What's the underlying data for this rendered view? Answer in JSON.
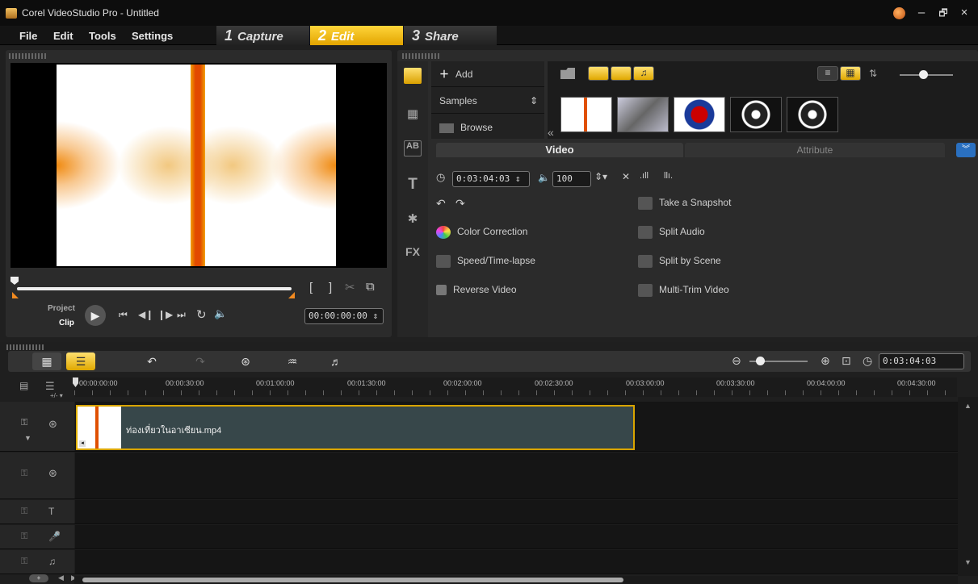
{
  "titlebar": {
    "title": "Corel VideoStudio Pro - Untitled"
  },
  "menu": {
    "items": [
      "File",
      "Edit",
      "Tools",
      "Settings"
    ]
  },
  "steps": [
    {
      "num": "1",
      "label": "Capture"
    },
    {
      "num": "2",
      "label": "Edit"
    },
    {
      "num": "3",
      "label": "Share"
    }
  ],
  "preview": {
    "project_label": "Project",
    "clip_label": "Clip",
    "timecode": "00:00:00:00",
    "progress": 0
  },
  "library": {
    "add_label": "Add",
    "folder_label": "Samples",
    "browse_label": "Browse",
    "collapse_glyph": "«",
    "tabs": {
      "video": "Video",
      "attribute": "Attribute"
    },
    "duration": "0:03:04:03",
    "volume": "100",
    "options_left": [
      "Color Correction",
      "Speed/Time-lapse",
      "Reverse Video"
    ],
    "options_right": [
      "Take a Snapshot",
      "Split Audio",
      "Split by Scene",
      "Multi-Trim Video"
    ]
  },
  "timeline": {
    "total_time": "0:03:04:03",
    "ruler": [
      "00:00:00:00",
      "00:00:30:00",
      "00:01:00:00",
      "00:01:30:00",
      "00:02:00:00",
      "00:02:30:00",
      "00:03:00:00",
      "00:03:30:00",
      "00:04:00:00",
      "00:04:30:00"
    ],
    "clip_name": "ท่องเที่ยวในอาเซียน.mp4"
  },
  "colors": {
    "accent": "#e6b000",
    "clip_bg": "#37474a",
    "scrub_marker": "#f28a20"
  }
}
